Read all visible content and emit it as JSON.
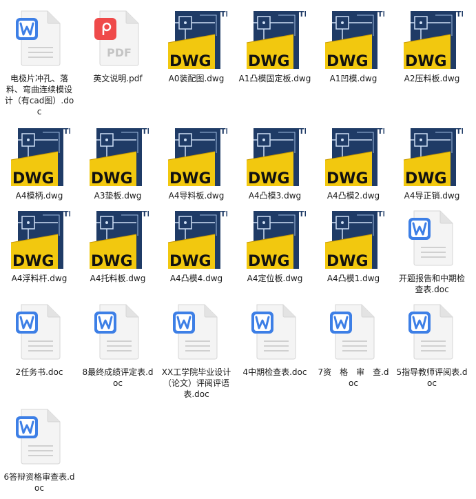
{
  "colors": {
    "dwg_yellow": "#f2c80f",
    "dwg_dark": "#1f3b66",
    "word_blue": "#3d7fe6",
    "pdf_red": "#ef4a4a"
  },
  "files": [
    {
      "name": "电极片冲孔、落料、弯曲连续模设计（有cad图）.doc",
      "type": "doc"
    },
    {
      "name": "英文说明.pdf",
      "type": "pdf"
    },
    {
      "name": "A0装配图.dwg",
      "type": "dwg"
    },
    {
      "name": "A1凸模固定板.dwg",
      "type": "dwg"
    },
    {
      "name": "A1凹模.dwg",
      "type": "dwg"
    },
    {
      "name": "A2压料板.dwg",
      "type": "dwg"
    },
    {
      "name": "A4模柄.dwg",
      "type": "dwg"
    },
    {
      "name": "A3垫板.dwg",
      "type": "dwg"
    },
    {
      "name": "A4导料板.dwg",
      "type": "dwg"
    },
    {
      "name": "A4凸模3.dwg",
      "type": "dwg"
    },
    {
      "name": "A4凸模2.dwg",
      "type": "dwg"
    },
    {
      "name": "A4导正销.dwg",
      "type": "dwg"
    },
    {
      "name": "A4浮料杆.dwg",
      "type": "dwg"
    },
    {
      "name": "A4托料板.dwg",
      "type": "dwg"
    },
    {
      "name": "A4凸模4.dwg",
      "type": "dwg"
    },
    {
      "name": "A4定位板.dwg",
      "type": "dwg"
    },
    {
      "name": "A4凸模1.dwg",
      "type": "dwg"
    },
    {
      "name": "开题报告和中期检查表.doc",
      "type": "doc"
    },
    {
      "name": "2任务书.doc",
      "type": "doc"
    },
    {
      "name": "8最终成绩评定表.doc",
      "type": "doc"
    },
    {
      "name": "XX工学院毕业设计（论文）评阅评语表.doc",
      "type": "doc"
    },
    {
      "name": "4中期检查表.doc",
      "type": "doc"
    },
    {
      "name": "7资　格　审　查.doc",
      "type": "doc"
    },
    {
      "name": "5指导教师评阅表.doc",
      "type": "doc"
    },
    {
      "name": "6答辩资格审查表.doc",
      "type": "doc"
    }
  ],
  "icons": {
    "dwg_badge": "DWG",
    "dwg_tm": "TM",
    "pdf_badge": "PDF"
  }
}
